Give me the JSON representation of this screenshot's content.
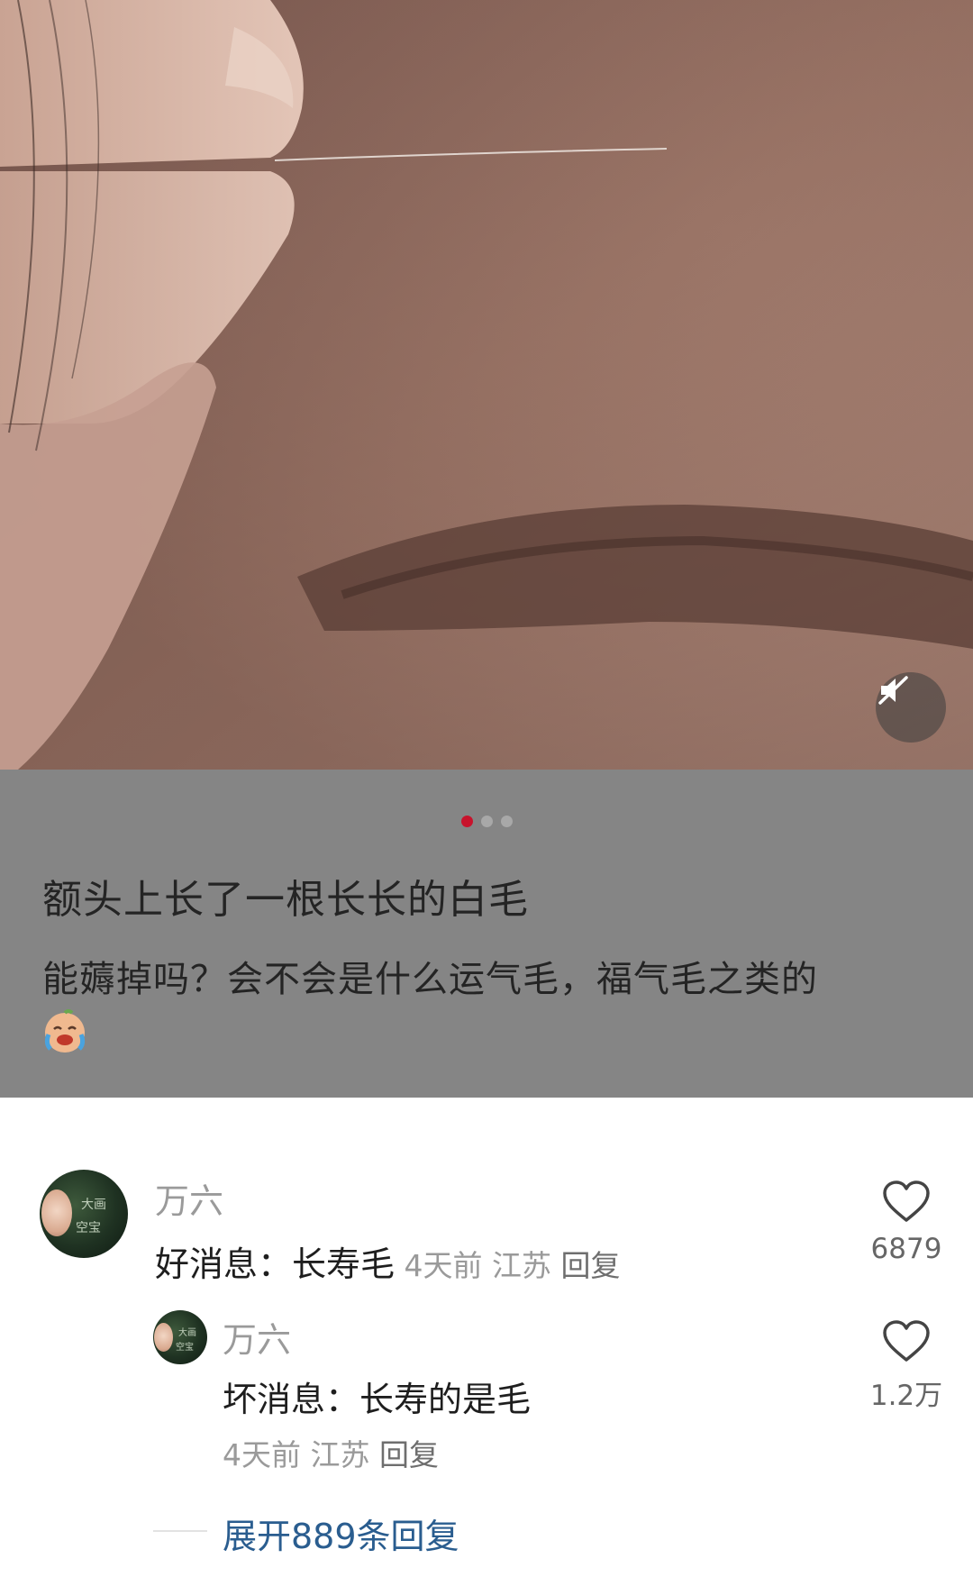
{
  "post": {
    "title": "额头上长了一根长长的白毛",
    "body": "能薅掉吗？会不会是什么运气毛，福气毛之类的",
    "emoji_name": "cry-laugh-emoji",
    "carousel": {
      "count": 3,
      "active_index": 0
    },
    "mute_icon": "mute-speaker-icon",
    "accent_color": "#c8132c"
  },
  "comments": [
    {
      "user": "万六",
      "text": "好消息：长寿毛",
      "time": "4天前",
      "location": "江苏",
      "reply_label": "回复",
      "likes": "6879",
      "replies": [
        {
          "user": "万六",
          "text": "坏消息：长寿的是毛",
          "time": "4天前",
          "location": "江苏",
          "reply_label": "回复",
          "likes": "1.2万"
        }
      ],
      "expand_label": "展开889条回复"
    }
  ]
}
